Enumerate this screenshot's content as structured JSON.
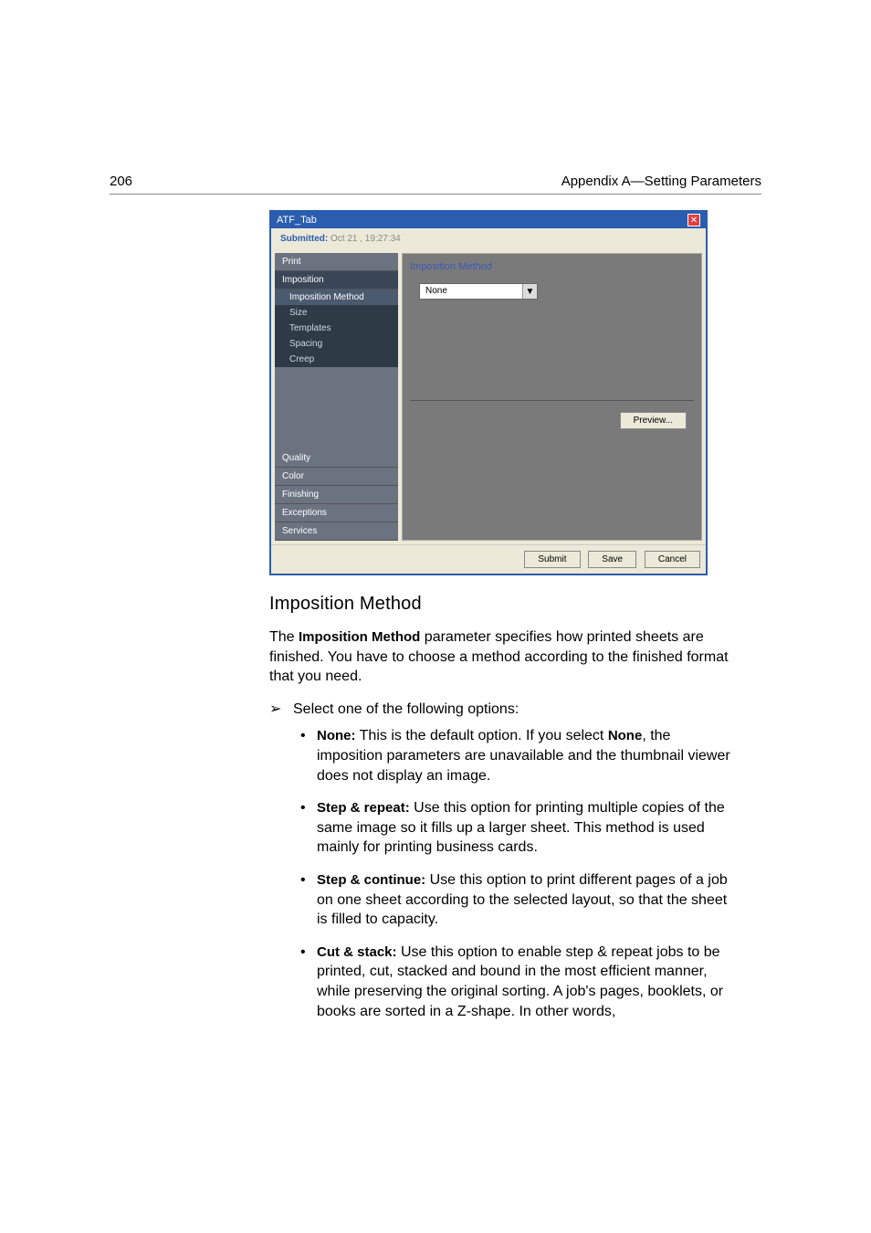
{
  "header": {
    "page_number": "206",
    "appendix": "Appendix A—Setting Parameters"
  },
  "dialog": {
    "title": "ATF_Tab",
    "submitted_label": "Submitted:",
    "submitted_value": "Oct 21 , 19:27:34",
    "sidebar": {
      "sections": [
        "Print",
        "Imposition",
        "Quality",
        "Color",
        "Finishing",
        "Exceptions",
        "Services"
      ],
      "subitems": [
        "Imposition Method",
        "Size",
        "Templates",
        "Spacing",
        "Creep"
      ]
    },
    "content": {
      "title": "Imposition Method",
      "dropdown_value": "None",
      "preview_label": "Preview..."
    },
    "footer": {
      "submit": "Submit",
      "save": "Save",
      "cancel": "Cancel"
    }
  },
  "article": {
    "heading": "Imposition Method",
    "intro_pre": "The ",
    "intro_bold": "Imposition Method",
    "intro_post": " parameter specifies how printed sheets are finished. You have to choose a method according to the finished format that you need.",
    "step_text": "Select one of the following options:",
    "bullets": [
      {
        "label": "None:",
        "text": " This is the default option. If you select ",
        "bold2": "None",
        "text2": ", the imposition parameters are unavailable and the thumbnail viewer does not display an image."
      },
      {
        "label": "Step & repeat:",
        "text": " Use this option for printing multiple copies of the same image so it fills up a larger sheet. This method is used mainly for printing business cards."
      },
      {
        "label": "Step & continue:",
        "text": " Use this option to print different pages of a job on one sheet according to the selected layout, so that the sheet is filled to capacity."
      },
      {
        "label": "Cut & stack:",
        "text": " Use this option to enable step & repeat jobs to be printed, cut, stacked and bound in the most efficient manner, while preserving the original sorting. A job's pages, booklets, or books are sorted in a Z-shape. In other words,"
      }
    ]
  }
}
